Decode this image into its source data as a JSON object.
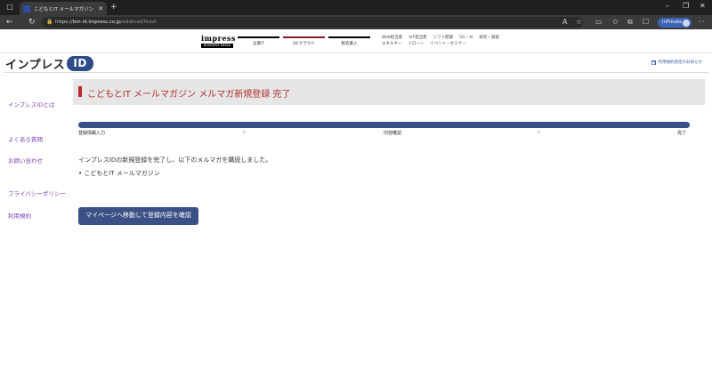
{
  "browser": {
    "tab_title": "こどもとIT メールマガジン メルマガ新規登",
    "url_scheme": "https://",
    "url_host": "bm-id.impress.co.jp",
    "url_path": "/addmail/finish",
    "profile_label": "InPrivate"
  },
  "impress_header": {
    "logo_top": "impress",
    "logo_bottom": "BUSINESS MEDIA",
    "tabs": [
      {
        "label": "企業IT",
        "color": "#000000"
      },
      {
        "label": "DCクラウド",
        "color": "#8b1a2b"
      },
      {
        "label": "製造業入",
        "color": "#000000"
      }
    ],
    "links_row1": [
      "Web担当者",
      "IoT担当者",
      "ソフト開発",
      "5G・AI",
      "研究・調査"
    ],
    "links_row2": [
      "エネルギー",
      "ドローン",
      "イベント・セミナー"
    ]
  },
  "brand": {
    "name": "インプレス",
    "badge": "ID",
    "maintenance_notice": "利用規約改定のお知らせ"
  },
  "sidebar": {
    "items": [
      {
        "label": "インプレスIDとは"
      },
      {
        "label": "よくある質問"
      },
      {
        "label": "お問い合わせ"
      },
      {
        "label": "プライバシーポリシー"
      },
      {
        "label": "利用規約"
      }
    ]
  },
  "main": {
    "title": "こどもとIT メールマガジン メルマガ新規登録 完了",
    "steps": [
      "登録情報入力",
      "内容確認",
      "完了"
    ],
    "step_arrow": "▷",
    "message": "インプレスIDの新規登録を完了し、以下のメルマガを購読しました。",
    "subscribed": "• こどもとIT メールマガジン",
    "button_label": "マイページへ移動して登録内容を確認"
  },
  "colors": {
    "accent_navy": "#3b5084",
    "title_red": "#b0302f",
    "link_purple": "#7b3fae"
  }
}
